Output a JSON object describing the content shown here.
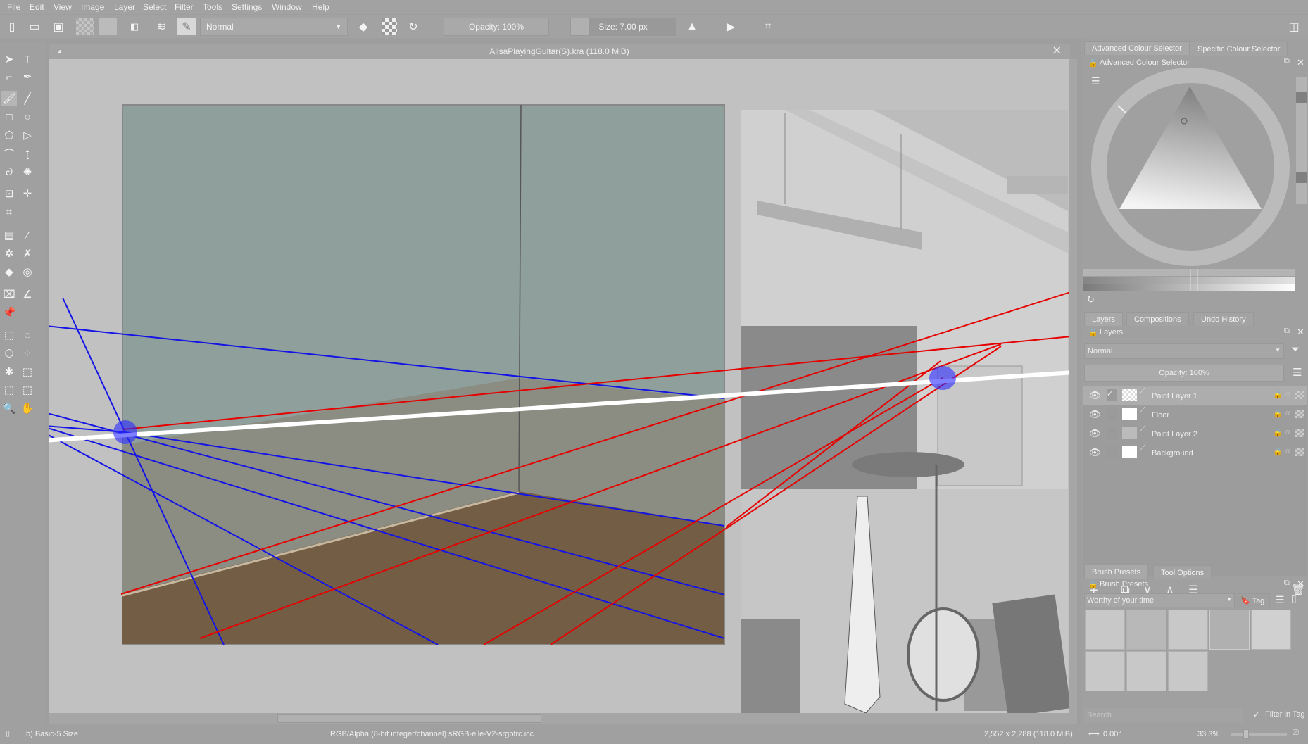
{
  "menu": [
    "File",
    "Edit",
    "View",
    "Image",
    "Layer",
    "Select",
    "Filter",
    "Tools",
    "Settings",
    "Window",
    "Help"
  ],
  "toolbar": {
    "blend_mode": "Normal",
    "opacity": "Opacity: 100%",
    "size": "Size: 7.00 px"
  },
  "document": {
    "title": "AlisaPlayingGuitar(S).kra (118.0 MiB)"
  },
  "colour": {
    "tabs": [
      "Advanced Colour Selector",
      "Specific Colour Selector"
    ],
    "header": "Advanced Colour Selector"
  },
  "layers": {
    "tabs": [
      "Layers",
      "Compositions",
      "Undo History"
    ],
    "header": "Layers",
    "blend_mode": "Normal",
    "opacity": "Opacity:  100%",
    "items": [
      {
        "name": "Paint Layer 1",
        "selected": true,
        "locked": false
      },
      {
        "name": "Floor",
        "selected": false,
        "locked": false
      },
      {
        "name": "Paint Layer 2",
        "selected": false,
        "locked": false
      },
      {
        "name": "Background",
        "selected": false,
        "locked": true
      }
    ]
  },
  "brushes": {
    "tabs": [
      "Brush Presets",
      "Tool Options"
    ],
    "header": "Brush Presets",
    "tag_filter": "Worthy of your time",
    "tag_label": "Tag",
    "search_placeholder": "Search",
    "filter_in_tag": "Filter in Tag"
  },
  "status": {
    "brush": "b) Basic-5 Size",
    "color_space": "RGB/Alpha (8-bit integer/channel)  sRGB-elle-V2-srgbtrc.icc",
    "dimensions": "2,552 x 2,288 (118.0 MiB)",
    "rotation": "0.00°",
    "zoom": "33.3%"
  },
  "colors": {
    "assistant_blue": "#1010e0",
    "assistant_red": "#e00000",
    "horizon": "#ffffff",
    "wall": "#8f9f9b",
    "lower_wall": "#8b8c82",
    "floor": "#735d45"
  }
}
